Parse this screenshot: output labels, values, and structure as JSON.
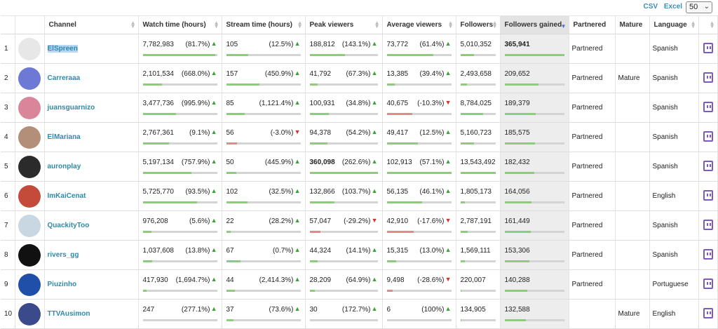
{
  "toolbar": {
    "csv_label": "CSV",
    "excel_label": "Excel",
    "page_size": "50"
  },
  "columns": {
    "channel": "Channel",
    "watch_time": "Watch time (hours)",
    "stream_time": "Stream time (hours)",
    "peak_viewers": "Peak viewers",
    "average_viewers": "Average viewers",
    "followers": "Followers",
    "followers_gained": "Followers gained",
    "partnered": "Partnered",
    "mature": "Mature",
    "language": "Language"
  },
  "colors": {
    "link": "#2d8aa8",
    "bar_positive": "#8ccc7a",
    "bar_negative": "#e08a8a",
    "twitch": "#7d5bbe"
  },
  "rows": [
    {
      "rank": "1",
      "channel": "ElSpreen",
      "watch": "7,782,983",
      "watch_pct": "(81.7%)",
      "watch_dir": "up",
      "watch_fill": 0.98,
      "stream": "105",
      "stream_pct": "(12.5%)",
      "stream_dir": "up",
      "stream_fill": 0.3,
      "peak": "188,812",
      "peak_pct": "(143.1%)",
      "peak_dir": "up",
      "peak_fill": 0.52,
      "avg": "73,772",
      "avg_pct": "(61.4%)",
      "avg_dir": "up",
      "avg_fill": 0.72,
      "followers": "5,010,352",
      "followers_fill": 0.38,
      "gained": "365,941",
      "gained_fill": 1.0,
      "partnered": "Partnered",
      "mature": "",
      "language": "Spanish",
      "avatar_color": "#e7e7e7",
      "selected": true,
      "peak_bold": false,
      "gained_bold": true
    },
    {
      "rank": "2",
      "channel": "Carreraaa",
      "watch": "2,101,534",
      "watch_pct": "(668.0%)",
      "watch_dir": "up",
      "watch_fill": 0.26,
      "stream": "157",
      "stream_pct": "(450.9%)",
      "stream_dir": "up",
      "stream_fill": 0.45,
      "peak": "41,792",
      "peak_pct": "(67.3%)",
      "peak_dir": "up",
      "peak_fill": 0.12,
      "avg": "13,385",
      "avg_pct": "(39.4%)",
      "avg_dir": "up",
      "avg_fill": 0.13,
      "followers": "2,493,658",
      "followers_fill": 0.19,
      "gained": "209,652",
      "gained_fill": 0.57,
      "partnered": "Partnered",
      "mature": "Mature",
      "language": "Spanish",
      "avatar_color": "#6c7ad6",
      "selected": false,
      "peak_bold": false,
      "gained_bold": false
    },
    {
      "rank": "3",
      "channel": "juansguarnizo",
      "watch": "3,477,736",
      "watch_pct": "(995.9%)",
      "watch_dir": "up",
      "watch_fill": 0.45,
      "stream": "85",
      "stream_pct": "(1,121.4%)",
      "stream_dir": "up",
      "stream_fill": 0.25,
      "peak": "100,931",
      "peak_pct": "(34.8%)",
      "peak_dir": "up",
      "peak_fill": 0.28,
      "avg": "40,675",
      "avg_pct": "(-10.3%)",
      "avg_dir": "down",
      "avg_fill": 0.4,
      "followers": "8,784,025",
      "followers_fill": 0.65,
      "gained": "189,379",
      "gained_fill": 0.52,
      "partnered": "Partnered",
      "mature": "",
      "language": "Spanish",
      "avatar_color": "#d9869b",
      "selected": false,
      "peak_bold": false,
      "gained_bold": false
    },
    {
      "rank": "4",
      "channel": "ElMariana",
      "watch": "2,767,361",
      "watch_pct": "(9.1%)",
      "watch_dir": "up",
      "watch_fill": 0.35,
      "stream": "56",
      "stream_pct": "(-3.0%)",
      "stream_dir": "down",
      "stream_fill": 0.15,
      "peak": "94,378",
      "peak_pct": "(54.2%)",
      "peak_dir": "up",
      "peak_fill": 0.26,
      "avg": "49,417",
      "avg_pct": "(12.5%)",
      "avg_dir": "up",
      "avg_fill": 0.48,
      "followers": "5,160,723",
      "followers_fill": 0.38,
      "gained": "185,575",
      "gained_fill": 0.51,
      "partnered": "Partnered",
      "mature": "",
      "language": "Spanish",
      "avatar_color": "#b38f7a",
      "selected": false,
      "peak_bold": false,
      "gained_bold": false
    },
    {
      "rank": "5",
      "channel": "auronplay",
      "watch": "5,197,134",
      "watch_pct": "(757.9%)",
      "watch_dir": "up",
      "watch_fill": 0.66,
      "stream": "50",
      "stream_pct": "(445.9%)",
      "stream_dir": "up",
      "stream_fill": 0.14,
      "peak": "360,098",
      "peak_pct": "(262.6%)",
      "peak_dir": "up",
      "peak_fill": 1.0,
      "avg": "102,913",
      "avg_pct": "(57.1%)",
      "avg_dir": "up",
      "avg_fill": 1.0,
      "followers": "13,543,492",
      "followers_fill": 1.0,
      "gained": "182,432",
      "gained_fill": 0.5,
      "partnered": "Partnered",
      "mature": "",
      "language": "Spanish",
      "avatar_color": "#2b2b2b",
      "selected": false,
      "peak_bold": true,
      "gained_bold": false
    },
    {
      "rank": "6",
      "channel": "ImKaiCenat",
      "watch": "5,725,770",
      "watch_pct": "(93.5%)",
      "watch_dir": "up",
      "watch_fill": 0.73,
      "stream": "102",
      "stream_pct": "(32.5%)",
      "stream_dir": "up",
      "stream_fill": 0.29,
      "peak": "132,866",
      "peak_pct": "(103.7%)",
      "peak_dir": "up",
      "peak_fill": 0.37,
      "avg": "56,135",
      "avg_pct": "(46.1%)",
      "avg_dir": "up",
      "avg_fill": 0.55,
      "followers": "1,805,173",
      "followers_fill": 0.13,
      "gained": "164,056",
      "gained_fill": 0.45,
      "partnered": "Partnered",
      "mature": "",
      "language": "English",
      "avatar_color": "#c44a3a",
      "selected": false,
      "peak_bold": false,
      "gained_bold": false
    },
    {
      "rank": "7",
      "channel": "QuackityToo",
      "watch": "976,208",
      "watch_pct": "(5.6%)",
      "watch_dir": "up",
      "watch_fill": 0.12,
      "stream": "22",
      "stream_pct": "(28.2%)",
      "stream_dir": "up",
      "stream_fill": 0.06,
      "peak": "57,047",
      "peak_pct": "(-29.2%)",
      "peak_dir": "down",
      "peak_fill": 0.16,
      "avg": "42,910",
      "avg_pct": "(-17.6%)",
      "avg_dir": "down",
      "avg_fill": 0.42,
      "followers": "2,787,191",
      "followers_fill": 0.21,
      "gained": "161,449",
      "gained_fill": 0.44,
      "partnered": "Partnered",
      "mature": "",
      "language": "Spanish",
      "avatar_color": "#c9d7e3",
      "selected": false,
      "peak_bold": false,
      "gained_bold": false
    },
    {
      "rank": "8",
      "channel": "rivers_gg",
      "watch": "1,037,608",
      "watch_pct": "(13.8%)",
      "watch_dir": "up",
      "watch_fill": 0.13,
      "stream": "67",
      "stream_pct": "(0.7%)",
      "stream_dir": "up",
      "stream_fill": 0.19,
      "peak": "44,324",
      "peak_pct": "(14.1%)",
      "peak_dir": "up",
      "peak_fill": 0.12,
      "avg": "15,315",
      "avg_pct": "(13.0%)",
      "avg_dir": "up",
      "avg_fill": 0.15,
      "followers": "1,569,111",
      "followers_fill": 0.12,
      "gained": "153,306",
      "gained_fill": 0.42,
      "partnered": "Partnered",
      "mature": "",
      "language": "Spanish",
      "avatar_color": "#111111",
      "selected": false,
      "peak_bold": false,
      "gained_bold": false
    },
    {
      "rank": "9",
      "channel": "Piuzinho",
      "watch": "417,930",
      "watch_pct": "(1,694.7%)",
      "watch_dir": "up",
      "watch_fill": 0.05,
      "stream": "44",
      "stream_pct": "(2,414.3%)",
      "stream_dir": "up",
      "stream_fill": 0.12,
      "peak": "28,209",
      "peak_pct": "(64.9%)",
      "peak_dir": "up",
      "peak_fill": 0.08,
      "avg": "9,498",
      "avg_pct": "(-28.6%)",
      "avg_dir": "down",
      "avg_fill": 0.09,
      "followers": "220,007",
      "followers_fill": 0.02,
      "gained": "140,288",
      "gained_fill": 0.38,
      "partnered": "Partnered",
      "mature": "",
      "language": "Portuguese",
      "avatar_color": "#1f4fa8",
      "selected": false,
      "peak_bold": false,
      "gained_bold": false
    },
    {
      "rank": "10",
      "channel": "TTVAusimon",
      "watch": "247",
      "watch_pct": "(277.1%)",
      "watch_dir": "up",
      "watch_fill": 0.0,
      "stream": "37",
      "stream_pct": "(73.6%)",
      "stream_dir": "up",
      "stream_fill": 0.1,
      "peak": "30",
      "peak_pct": "(172.7%)",
      "peak_dir": "up",
      "peak_fill": 0.0,
      "avg": "6",
      "avg_pct": "(100%)",
      "avg_dir": "up",
      "avg_fill": 0.0,
      "followers": "134,905",
      "followers_fill": 0.01,
      "gained": "132,588",
      "gained_fill": 0.36,
      "partnered": "",
      "mature": "Mature",
      "language": "English",
      "avatar_color": "#3b4a8a",
      "selected": false,
      "peak_bold": false,
      "gained_bold": false
    }
  ]
}
